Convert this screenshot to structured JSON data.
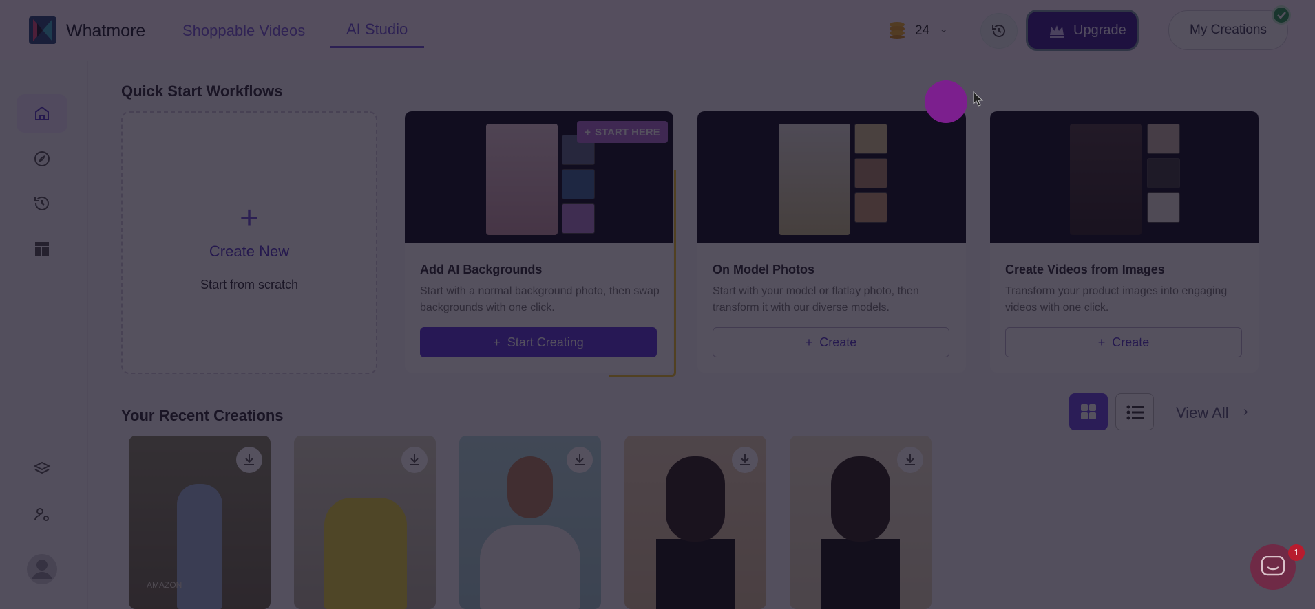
{
  "header": {
    "brand": "Whatmore",
    "tabs": [
      {
        "label": "Shoppable Videos"
      },
      {
        "label": "AI Studio"
      }
    ],
    "coins": "24",
    "upgrade_label": "Upgrade",
    "my_creations_label": "My Creations"
  },
  "sidebar": {
    "items": [
      "home-icon",
      "compass-icon",
      "history-icon",
      "layout-icon",
      "layers-icon",
      "user-settings-icon",
      "profile-icon"
    ]
  },
  "quick_start": {
    "title": "Quick Start Workflows",
    "create_new": {
      "plus": "+",
      "title": "Create New",
      "subtitle": "Start from scratch"
    },
    "cards": [
      {
        "title": "Add AI Backgrounds",
        "desc": "Start with a normal background photo, then swap backgrounds with one click.",
        "button": "Start Creating",
        "badge": "START HERE"
      },
      {
        "title": "On Model Photos",
        "desc": "Start with your model or flatlay photo, then transform it with our diverse models.",
        "button": "Create"
      },
      {
        "title": "Create Videos from Images",
        "desc": "Transform your product images into engaging videos with one click.",
        "button": "Create"
      }
    ]
  },
  "recent": {
    "title": "Your Recent Creations",
    "view_all": "View All",
    "items": [
      {
        "caption": "AMAZON"
      },
      {
        "caption": ""
      },
      {
        "caption": ""
      },
      {
        "caption": ""
      },
      {
        "caption": ""
      }
    ]
  },
  "chat": {
    "badge": "1"
  },
  "colors": {
    "accent": "#6d4fd6",
    "upgrade": "#3a1c8f",
    "highlight": "#f0c62a"
  }
}
